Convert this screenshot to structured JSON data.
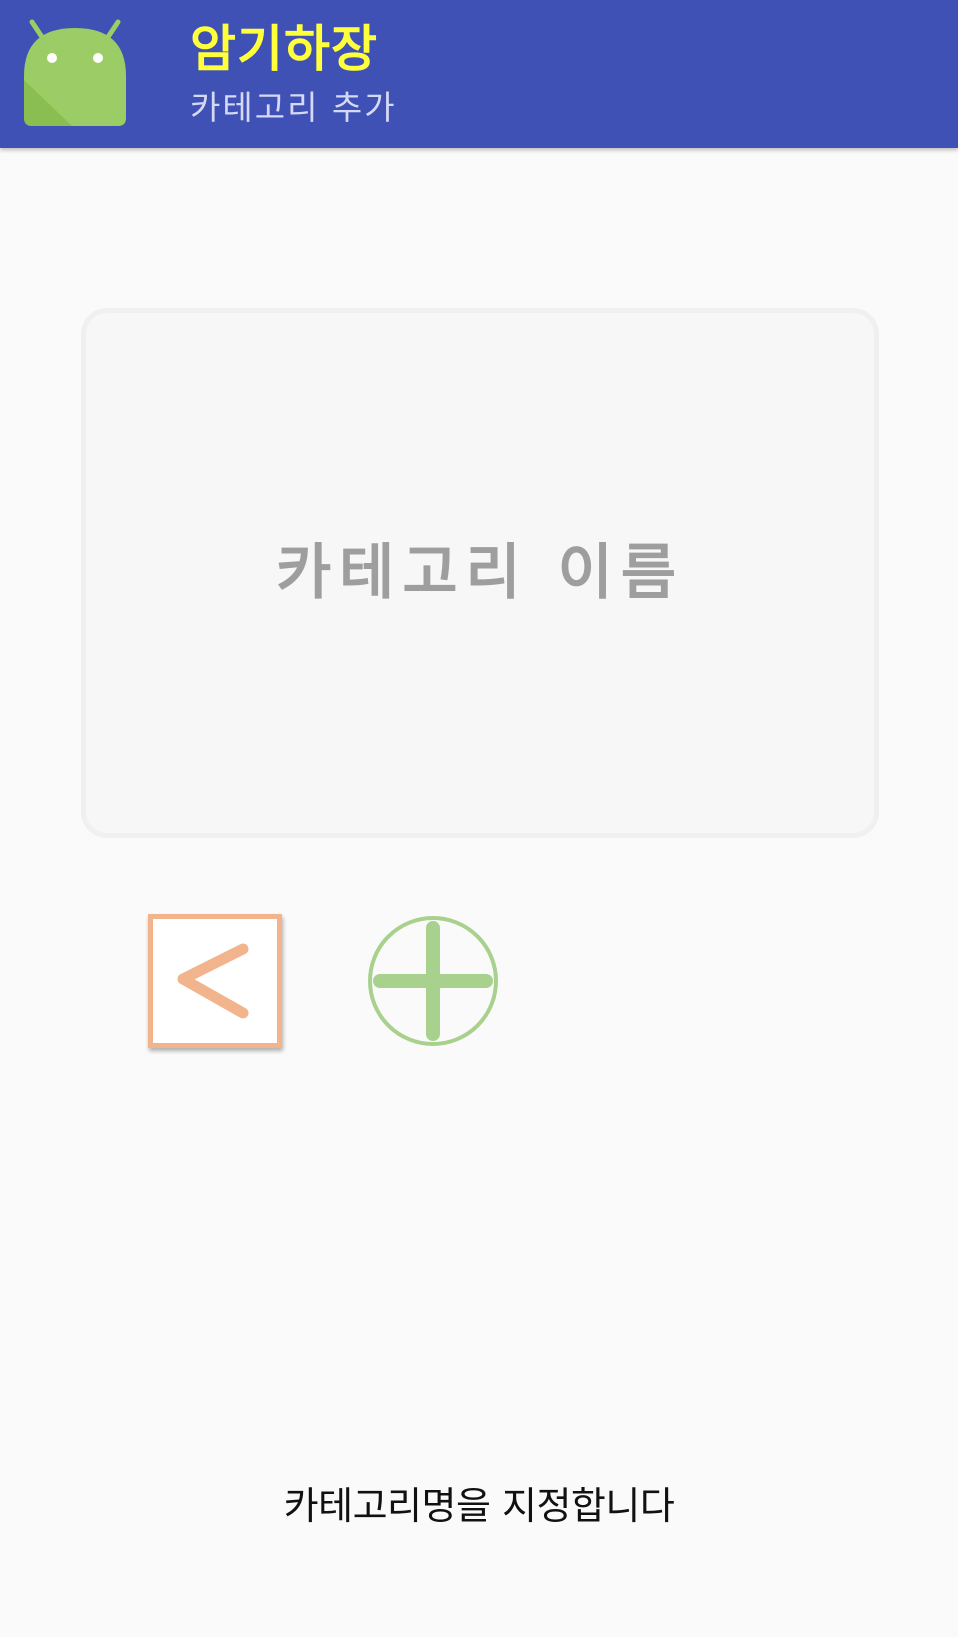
{
  "app_bar": {
    "icon": "android-robot-icon",
    "title": "암기하장",
    "subtitle": "카테고리 추가",
    "background_color": "#3f51b5",
    "title_color": "#ffff3b"
  },
  "category_form": {
    "name_input": {
      "value": "",
      "placeholder": "카테고리 이름"
    }
  },
  "actions": {
    "back_button": {
      "icon": "chevron-left-icon",
      "accent_color": "#f2b48c"
    },
    "add_button": {
      "icon": "plus-circle-icon",
      "accent_color": "#a9d18e"
    }
  },
  "footer": {
    "hint": "카테고리명을 지정합니다"
  }
}
